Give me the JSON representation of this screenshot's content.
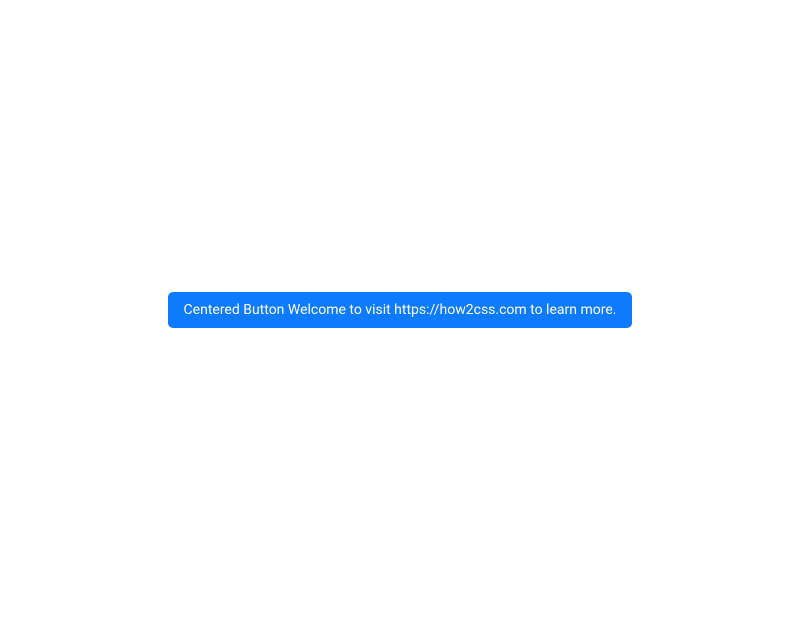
{
  "button": {
    "label": "Centered Button Welcome to visit https://how2css.com to learn more."
  }
}
